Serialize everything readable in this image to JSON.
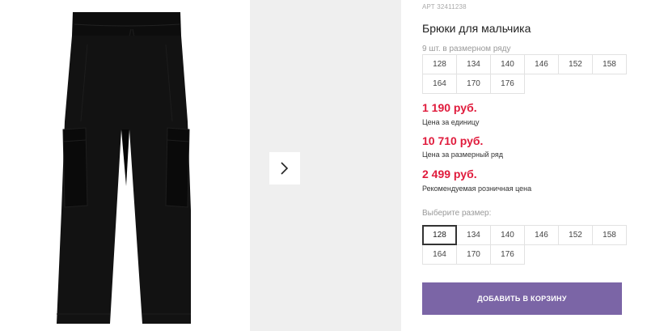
{
  "product": {
    "sku": "АРТ 32411238",
    "title": "Брюки для мальчика",
    "image_icon": "pants-image",
    "next_icon": "chevron-right-icon"
  },
  "pack": {
    "note": "9 шт. в размерном ряду",
    "sizes": [
      "128",
      "134",
      "140",
      "146",
      "152",
      "158",
      "164",
      "170",
      "176"
    ]
  },
  "prices": {
    "unit_price": "1 190 руб.",
    "unit_label": "Цена за единицу",
    "pack_price": "10 710 руб.",
    "pack_label": "Цена за размерный ряд",
    "retail_price": "2 499 руб.",
    "retail_label": "Рекомендуемая розничная цена"
  },
  "size_select": {
    "label": "Выберите размер:",
    "sizes": [
      "128",
      "134",
      "140",
      "146",
      "152",
      "158",
      "164",
      "170",
      "176"
    ],
    "selected": "128"
  },
  "cart": {
    "button_label": "ДОБАВИТЬ В КОРЗИНУ",
    "button_color": "#7b65a6"
  },
  "colors": {
    "price": "#e01b3c",
    "gallery_bg": "#efefef"
  }
}
